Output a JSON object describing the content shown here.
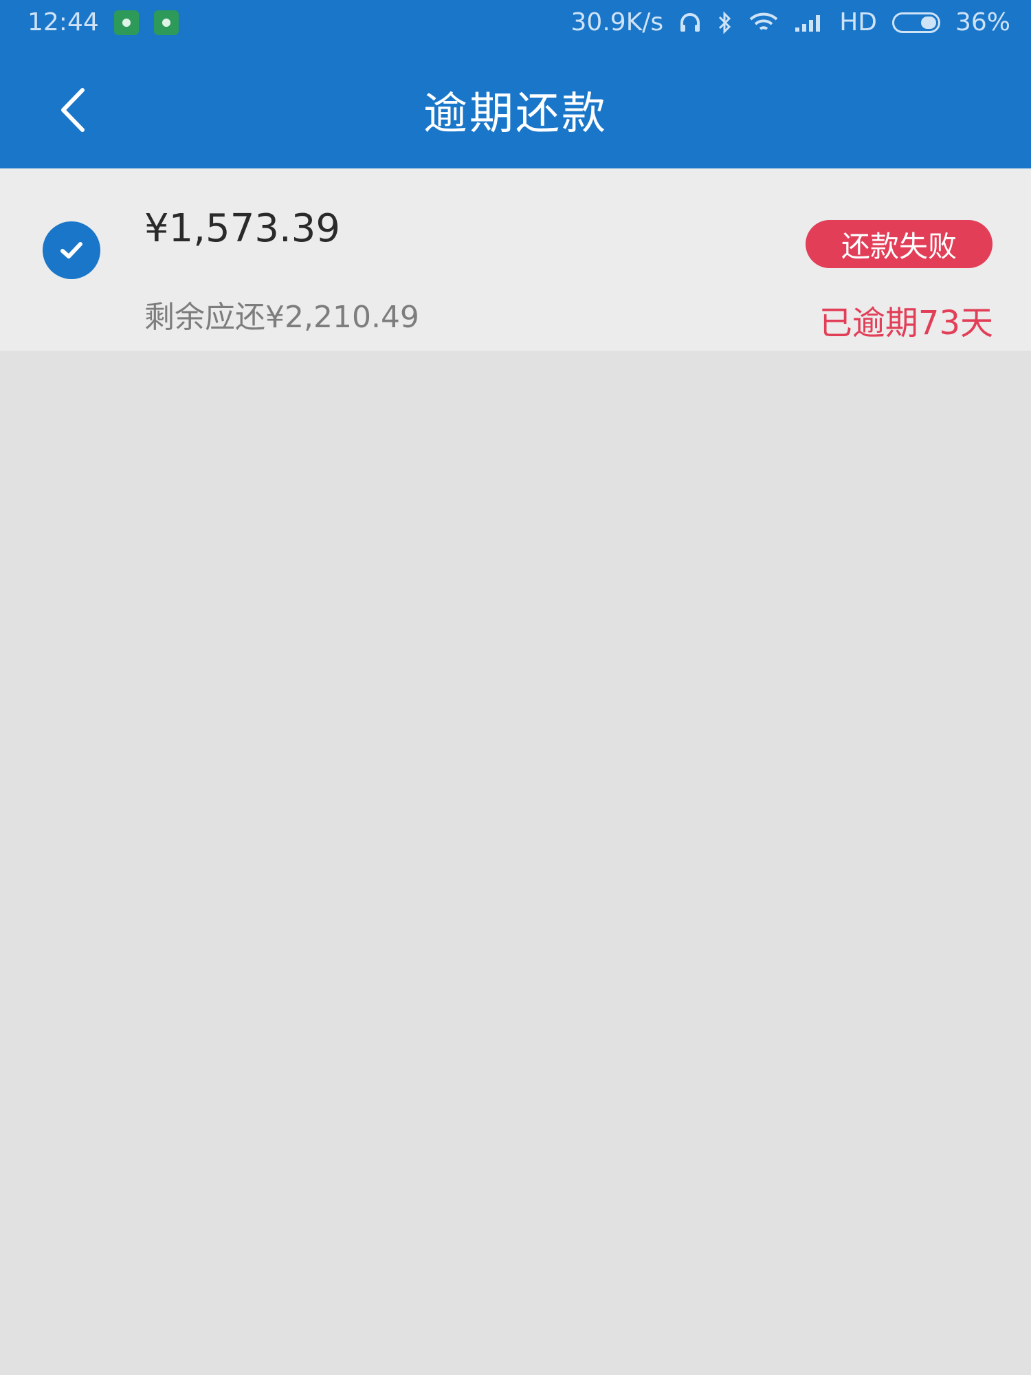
{
  "status_bar": {
    "time": "12:44",
    "network_speed": "30.9K/s",
    "network_type": "HD",
    "battery": "36%",
    "icons": [
      "notification-app-icon",
      "notification-dot-icon",
      "headset-icon",
      "bluetooth-icon",
      "wifi-icon",
      "signal-icon",
      "battery-icon"
    ]
  },
  "header": {
    "title": "逾期还款"
  },
  "loan_item": {
    "amount": "¥1,573.39",
    "remaining": "剩余应还¥2,210.49",
    "status_badge": "还款失败",
    "overdue_text": "已逾期73天",
    "selected": true
  },
  "colors": {
    "primary": "#1a76c9",
    "danger": "#e23e57",
    "background": "#e3e3e3"
  }
}
